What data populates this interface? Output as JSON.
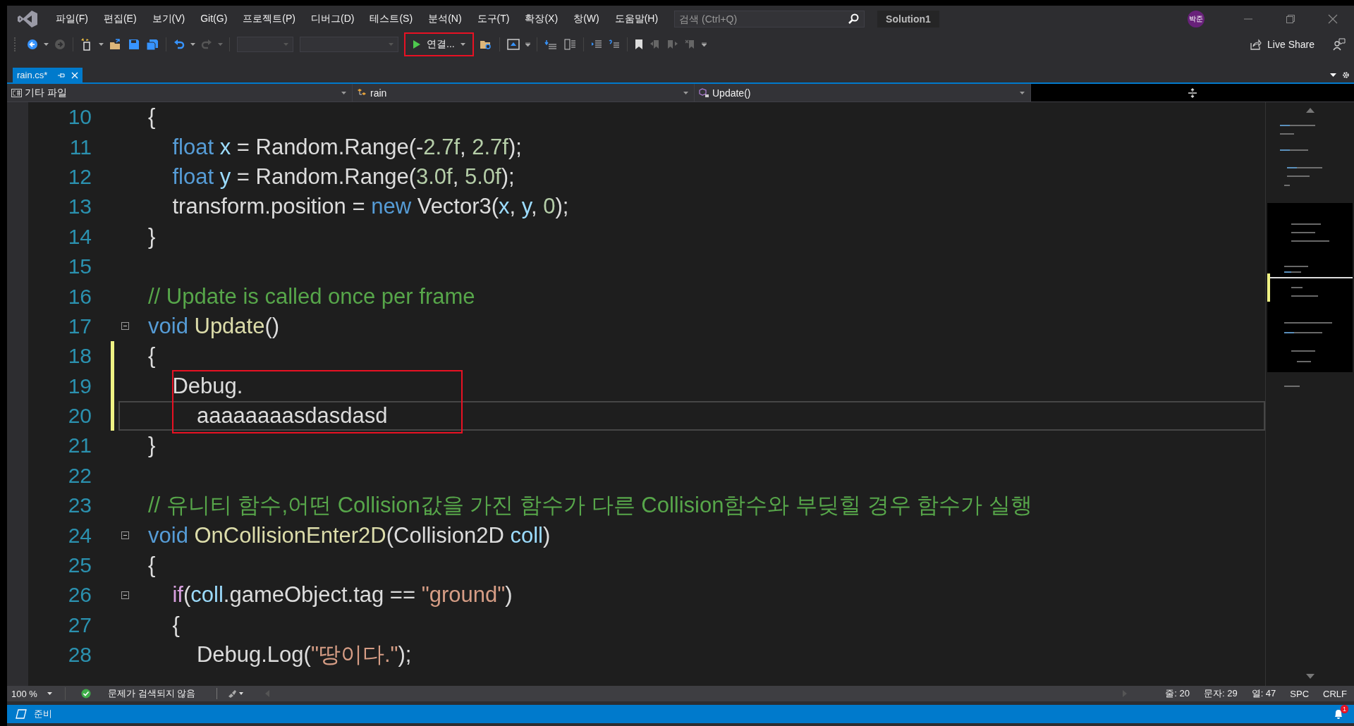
{
  "title_bar": {
    "menu": [
      "파일(F)",
      "편집(E)",
      "보기(V)",
      "Git(G)",
      "프로젝트(P)",
      "디버그(D)",
      "테스트(S)",
      "분석(N)",
      "도구(T)",
      "확장(X)",
      "창(W)",
      "도움말(H)"
    ],
    "search": {
      "placeholder": "검색 (Ctrl+Q)"
    },
    "solution": "Solution1",
    "avatar": "박준"
  },
  "toolbar": {
    "run_button": {
      "label": "연결...",
      "boxed": true
    },
    "live_share": "Live Share"
  },
  "tabs": [
    {
      "label": "rain.cs*",
      "selected": true
    }
  ],
  "nav_bar": {
    "project": "기타 파일",
    "type": "rain",
    "member": "Update()"
  },
  "editor": {
    "lines": [
      {
        "number": "10",
        "changed": false,
        "current": false,
        "fold": false,
        "boxed": false,
        "tokens": [
          {
            "kind": "plain",
            "text": "{"
          }
        ]
      },
      {
        "number": "11",
        "changed": false,
        "current": false,
        "fold": false,
        "boxed": false,
        "tokens": [
          {
            "kind": "kw",
            "text": "    float"
          },
          {
            "kind": "var",
            "text": " x"
          },
          {
            "kind": "plain",
            "text": " = Random.Range(-"
          },
          {
            "kind": "num",
            "text": "2.7f"
          },
          {
            "kind": "plain",
            "text": ", "
          },
          {
            "kind": "num",
            "text": "2.7f"
          },
          {
            "kind": "plain",
            "text": ");"
          }
        ]
      },
      {
        "number": "12",
        "changed": false,
        "current": false,
        "fold": false,
        "boxed": false,
        "tokens": [
          {
            "kind": "kw",
            "text": "    float"
          },
          {
            "kind": "var",
            "text": " y"
          },
          {
            "kind": "plain",
            "text": " = Random.Range("
          },
          {
            "kind": "num",
            "text": "3.0f"
          },
          {
            "kind": "plain",
            "text": ", "
          },
          {
            "kind": "num",
            "text": "5.0f"
          },
          {
            "kind": "plain",
            "text": ");"
          }
        ]
      },
      {
        "number": "13",
        "changed": false,
        "current": false,
        "fold": false,
        "boxed": false,
        "tokens": [
          {
            "kind": "plain",
            "text": "    transform.position = "
          },
          {
            "kind": "kw",
            "text": "new"
          },
          {
            "kind": "plain",
            "text": " Vector3("
          },
          {
            "kind": "var",
            "text": "x"
          },
          {
            "kind": "plain",
            "text": ", "
          },
          {
            "kind": "var",
            "text": "y"
          },
          {
            "kind": "plain",
            "text": ", "
          },
          {
            "kind": "num",
            "text": "0"
          },
          {
            "kind": "plain",
            "text": ");"
          }
        ]
      },
      {
        "number": "14",
        "changed": false,
        "current": false,
        "fold": false,
        "boxed": false,
        "tokens": [
          {
            "kind": "plain",
            "text": "}"
          }
        ]
      },
      {
        "number": "15",
        "changed": false,
        "current": false,
        "fold": false,
        "boxed": false
      },
      {
        "number": "16",
        "changed": false,
        "current": false,
        "fold": false,
        "boxed": false,
        "tokens": [
          {
            "kind": "comment",
            "text": "// Update is called once per frame"
          }
        ]
      },
      {
        "number": "17",
        "changed": false,
        "current": false,
        "fold": true,
        "boxed": false,
        "tokens": [
          {
            "kind": "kw",
            "text": "void"
          },
          {
            "kind": "method",
            "text": " Update"
          },
          {
            "kind": "plain",
            "text": "()"
          }
        ]
      },
      {
        "number": "18",
        "changed": true,
        "current": false,
        "fold": false,
        "boxed": false,
        "tokens": [
          {
            "kind": "plain",
            "text": "{"
          }
        ]
      },
      {
        "number": "19",
        "changed": true,
        "current": false,
        "fold": false,
        "boxed": true,
        "tokens": [
          {
            "kind": "plain",
            "text": "    Debug."
          }
        ]
      },
      {
        "number": "20",
        "changed": true,
        "current": true,
        "fold": false,
        "boxed": true,
        "tokens": [
          {
            "kind": "plain",
            "text": "        aaaaaaaasdasdasd"
          }
        ]
      },
      {
        "number": "21",
        "changed": false,
        "current": false,
        "fold": false,
        "boxed": false,
        "tokens": [
          {
            "kind": "plain",
            "text": "}"
          }
        ]
      },
      {
        "number": "22",
        "changed": false,
        "current": false,
        "fold": false,
        "boxed": false
      },
      {
        "number": "23",
        "changed": false,
        "current": false,
        "fold": false,
        "boxed": false,
        "tokens": [
          {
            "kind": "comment",
            "text": "// 유니티 함수,어떤 Collision값을 가진 함수가 다른 Collision함수와 부딪힐 경우 함수가 실행"
          }
        ]
      },
      {
        "number": "24",
        "changed": false,
        "current": false,
        "fold": true,
        "boxed": false,
        "tokens": [
          {
            "kind": "kw",
            "text": "void"
          },
          {
            "kind": "method",
            "text": " OnCollisionEnter2D"
          },
          {
            "kind": "plain",
            "text": "(Collision2D "
          },
          {
            "kind": "var",
            "text": "coll"
          },
          {
            "kind": "plain",
            "text": ")"
          }
        ]
      },
      {
        "number": "25",
        "changed": false,
        "current": false,
        "fold": false,
        "boxed": false,
        "tokens": [
          {
            "kind": "plain",
            "text": "{"
          }
        ]
      },
      {
        "number": "26",
        "changed": false,
        "current": false,
        "fold": true,
        "boxed": false,
        "tokens": [
          {
            "kind": "ctrl",
            "text": "    if"
          },
          {
            "kind": "plain",
            "text": "("
          },
          {
            "kind": "var",
            "text": "coll"
          },
          {
            "kind": "plain",
            "text": ".gameObject.tag == "
          },
          {
            "kind": "str",
            "text": "\"ground\""
          },
          {
            "kind": "plain",
            "text": ")"
          }
        ]
      },
      {
        "number": "27",
        "changed": false,
        "current": false,
        "fold": false,
        "boxed": false,
        "tokens": [
          {
            "kind": "plain",
            "text": "    {"
          }
        ]
      },
      {
        "number": "28",
        "changed": false,
        "current": false,
        "fold": false,
        "boxed": false,
        "tokens": [
          {
            "kind": "plain",
            "text": "        Debug.Log("
          },
          {
            "kind": "str",
            "text": "\"땅이다.\""
          },
          {
            "kind": "plain",
            "text": ");"
          }
        ]
      }
    ]
  },
  "status_strip": {
    "zoom": "100 %",
    "issues": "문제가 검색되지 않음",
    "line": "줄: 20",
    "char": "문자: 29",
    "col": "열: 47",
    "spaces": "SPC",
    "eol": "CRLF"
  },
  "status_bar": {
    "text": "준비",
    "notifications": "1"
  }
}
